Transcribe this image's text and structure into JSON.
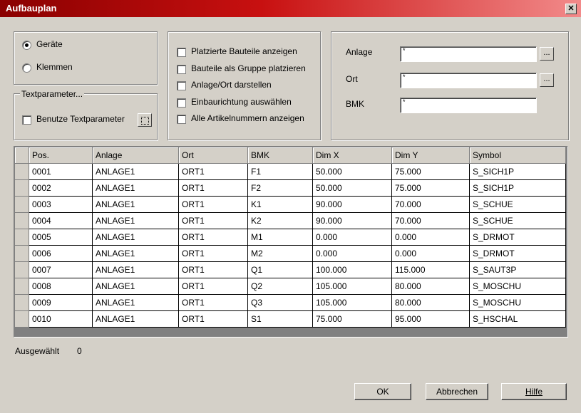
{
  "window": {
    "title": "Aufbauplan"
  },
  "mode": {
    "options": [
      "Geräte",
      "Klemmen"
    ],
    "selected": "Geräte"
  },
  "textparameter": {
    "group_label": "Textparameter...",
    "checkbox_label": "Benutze Textparameter"
  },
  "options": [
    "Platzierte Bauteile anzeigen",
    "Bauteile als Gruppe platzieren",
    "Anlage/Ort darstellen",
    "Einbaurichtung auswählen",
    "Alle Artikelnummern anzeigen"
  ],
  "filters": {
    "anlage": {
      "label": "Anlage",
      "value": "*"
    },
    "ort": {
      "label": "Ort",
      "value": "*"
    },
    "bmk": {
      "label": "BMK",
      "value": "*"
    }
  },
  "table": {
    "columns": [
      "Pos.",
      "Anlage",
      "Ort",
      "BMK",
      "Dim X",
      "Dim Y",
      "Symbol"
    ],
    "rows": [
      [
        "0001",
        "ANLAGE1",
        "ORT1",
        "F1",
        "50.000",
        "75.000",
        "S_SICH1P"
      ],
      [
        "0002",
        "ANLAGE1",
        "ORT1",
        "F2",
        "50.000",
        "75.000",
        "S_SICH1P"
      ],
      [
        "0003",
        "ANLAGE1",
        "ORT1",
        "K1",
        "90.000",
        "70.000",
        "S_SCHUE"
      ],
      [
        "0004",
        "ANLAGE1",
        "ORT1",
        "K2",
        "90.000",
        "70.000",
        "S_SCHUE"
      ],
      [
        "0005",
        "ANLAGE1",
        "ORT1",
        "M1",
        " 0.000",
        " 0.000",
        "S_DRMOT"
      ],
      [
        "0006",
        "ANLAGE1",
        "ORT1",
        "M2",
        " 0.000",
        " 0.000",
        "S_DRMOT"
      ],
      [
        "0007",
        "ANLAGE1",
        "ORT1",
        "Q1",
        "100.000",
        "115.000",
        "S_SAUT3P"
      ],
      [
        "0008",
        "ANLAGE1",
        "ORT1",
        "Q2",
        "105.000",
        "80.000",
        "S_MOSCHU"
      ],
      [
        "0009",
        "ANLAGE1",
        "ORT1",
        "Q3",
        "105.000",
        "80.000",
        "S_MOSCHU"
      ],
      [
        "0010",
        "ANLAGE1",
        "ORT1",
        "S1",
        "75.000",
        "95.000",
        "S_HSCHAL"
      ]
    ]
  },
  "status": {
    "label": "Ausgewählt",
    "count": "0"
  },
  "buttons": {
    "ok": "OK",
    "cancel": "Abbrechen",
    "help": "Hilfe"
  },
  "icons": {
    "close": "close-icon",
    "browse": "ellipsis-icon",
    "textparam": "dotted-square-icon"
  }
}
